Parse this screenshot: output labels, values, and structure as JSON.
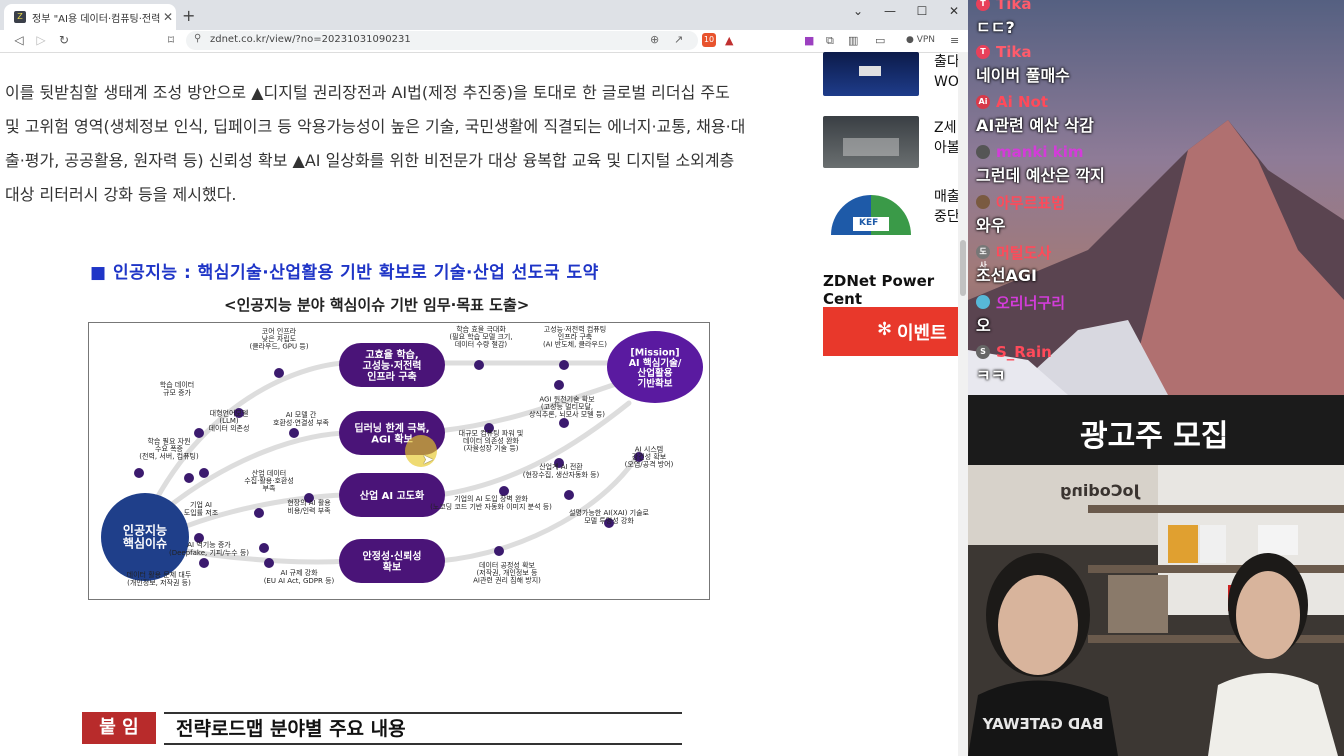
{
  "browser": {
    "tab_title": "정부 \"AI용 데이터·컴퓨팅·전력 부",
    "url": "zdnet.co.kr/view/?no=20231031090231",
    "vpn_label": "VPN",
    "brave_count": "10"
  },
  "article": {
    "lines": [
      "이를 뒷받침할 생태계 조성 방안으로 ▲디지털 권리장전과 AI법(제정 추진중)을 토대로 한 글로벌 리더십 주도",
      "및 고위험 영역(생체정보 인식, 딥페이크 등 악용가능성이 높은 기술, 국민생활에 직결되는 에너지·교통, 채용·대",
      "출·평가, 공공활용, 원자력 등) 신뢰성 확보 ▲AI 일상화를 위한 비전문가 대상 융복합 교육 및 디지털 소외계층",
      "대상 리터러시 강화 등을 제시했다."
    ]
  },
  "figure": {
    "title": "■ 인공지능 : 핵심기술·산업활용 기반 확보로 기술·산업 선도국 도약",
    "subtitle": "<인공지능 분야 핵심이슈 기반 임무·목표 도출>",
    "center_node": "인공지능\n핵심이슈",
    "mission_node": "[Mission]\nAI 핵심기술/\n산업활용\n기반확보",
    "track_nodes": [
      "고효율 학습,\n고성능·저전력\n인프라 구축",
      "딥러닝 한계 극복,\nAGI 확보",
      "산업 AI 고도화",
      "안정성·신뢰성\n확보"
    ],
    "issue_labels": [
      "코어 인프라\n낮은 자립도\n(클라우드, GPU 등)",
      "학습 데이터\n규모 증가",
      "대형언어모델\n(LLM)\n데이터 의존성",
      "AI 모델 간\n호환성·연결성 부족",
      "학습 필요 자원\n수요 폭증\n(전력, 서버, 컴퓨팅)",
      "산업 데이터\n수집·활용·호환성\n부족",
      "기업 AI\n도입률 저조",
      "현장의 AI 활용\n비용/인력 부족",
      "AI 역기능 증가\n(Deepfake, 기피/누수 등)",
      "데이터 활용 문제 대두\n(개인정보, 저작권 등)",
      "AI 규제 강화\n(EU AI Act, GDPR 등)"
    ],
    "goal_labels": [
      "학습 효율 극대화\n(필요 학습 모델 크기,\n데이터 수량 절감)",
      "고성능·저전력 컴퓨팅\n인프라 구축\n(AI 반도체, 클라우드)",
      "AGI 원천기술 확보\n(고성능 멀티모달,\n상식추론, 뇌모사 모델 등)",
      "대규모 컴퓨팅 파워 및\n데이터 의존성 완화\n(자율성장 기술 등)",
      "산업계 AI 전환\n(현장수집, 생산자동화 등)",
      "기업의 AI 도입 장벽 완화\n(노코딩 코드 기반 자동화 이미지 분석 등)",
      "AI 시스템\n강건성 확보\n(오염/공격 방어)",
      "설명가능한 AI(XAI) 기술로\n모델 투명성 강화",
      "데이터 공정성 확보\n(저작권, 개인정보 등\nAI관련 권리 침해 방지)"
    ]
  },
  "annex": {
    "tag": "붙 임",
    "title": "전략로드맵 분야별 주요 내용"
  },
  "sidebar": {
    "items": [
      {
        "text": "출다\nWO"
      },
      {
        "text": "Z세\n아볼"
      },
      {
        "text": "매출\n중단"
      }
    ],
    "thumb3_logo": "KEF",
    "power_center": "ZDNet Power Cent",
    "event_label": "이벤트"
  },
  "chat": {
    "messages": [
      {
        "name": "Tika",
        "text": "ㄷㄷ?",
        "name_color": "#ff5b6b",
        "avatar_color": "#e8405a",
        "avatar": "T"
      },
      {
        "name": "Tika",
        "text": "네이버 풀매수",
        "name_color": "#ff5b6b",
        "avatar_color": "#e8405a",
        "avatar": "T"
      },
      {
        "name": "Ai Not",
        "text": "AI관련 예산 삭감",
        "name_color": "#ff4a5a",
        "avatar_color": "#d83a4a",
        "avatar": "Ai"
      },
      {
        "name": "manki kim",
        "text": "그런데 예산은 깍지",
        "name_color": "#d33cd9",
        "avatar_color": "#555555",
        "avatar": ""
      },
      {
        "name": "아무르표범",
        "text": "와우",
        "name_color": "#ff4a5a",
        "avatar_color": "#7a5a40",
        "avatar": ""
      },
      {
        "name": "머털도사",
        "text": "조선AGI",
        "name_color": "#ff4a5a",
        "avatar_color": "#777777",
        "avatar": "도사"
      },
      {
        "name": "오리너구리",
        "text": "오",
        "name_color": "#d33cd9",
        "avatar_color": "#57b8d8",
        "avatar": ""
      },
      {
        "name": "S_Rain",
        "text": "ㅋㅋ",
        "name_color": "#ff4a5a",
        "avatar_color": "#666666",
        "avatar": "S"
      }
    ]
  },
  "ad_banner": "광고주 모집",
  "webcam": {
    "sign_text": "JoCoding",
    "shirt_text": "BAD GATEWAY"
  }
}
